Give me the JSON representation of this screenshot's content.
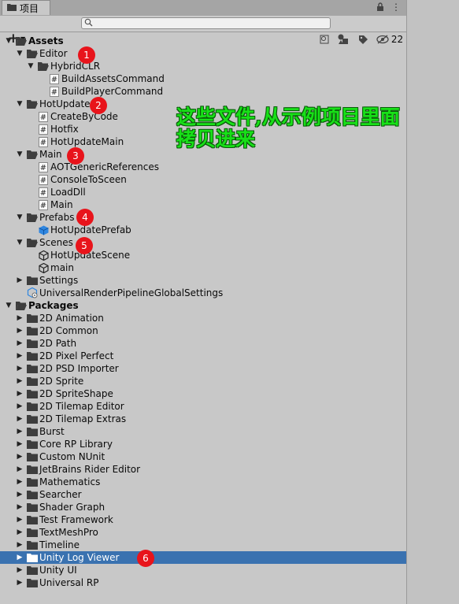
{
  "window": {
    "tab_label": "项目",
    "hidden_count": "22"
  },
  "toolbar": {
    "add_label": "+",
    "search_value": ""
  },
  "annotation": {
    "line1": "这些文件,从示例项目里面",
    "line2": "拷贝进来"
  },
  "tree": {
    "assets": "Assets",
    "editor": "Editor",
    "hybridclr": "HybridCLR",
    "build_assets_command": "BuildAssetsCommand",
    "build_player_command": "BuildPlayerCommand",
    "hotupdate": "HotUpdate",
    "create_by_code": "CreateByCode",
    "hotfix": "Hotfix",
    "hotupdate_main": "HotUpdateMain",
    "main": "Main",
    "aot_generic_references": "AOTGenericReferences",
    "console_to_sceen": "ConsoleToSceen",
    "load_dll": "LoadDll",
    "main_script": "Main",
    "prefabs": "Prefabs",
    "hotupdate_prefab": "HotUpdatePrefab",
    "scenes": "Scenes",
    "hotupdate_scene": "HotUpdateScene",
    "main_scene": "main",
    "settings": "Settings",
    "urp_global_settings": "UniversalRenderPipelineGlobalSettings",
    "packages": "Packages"
  },
  "packages": [
    "2D Animation",
    "2D Common",
    "2D Path",
    "2D Pixel Perfect",
    "2D PSD Importer",
    "2D Sprite",
    "2D SpriteShape",
    "2D Tilemap Editor",
    "2D Tilemap Extras",
    "Burst",
    "Core RP Library",
    "Custom NUnit",
    "JetBrains Rider Editor",
    "Mathematics",
    "Searcher",
    "Shader Graph",
    "Test Framework",
    "TextMeshPro",
    "Timeline",
    "Unity Log Viewer",
    "Unity UI",
    "Universal RP"
  ],
  "selected_package": "Unity Log Viewer",
  "badges": [
    "1",
    "2",
    "3",
    "4",
    "5",
    "6"
  ],
  "colors": {
    "selection": "#3a72b0",
    "badge": "#e8141b",
    "annotation": "#18e018"
  }
}
